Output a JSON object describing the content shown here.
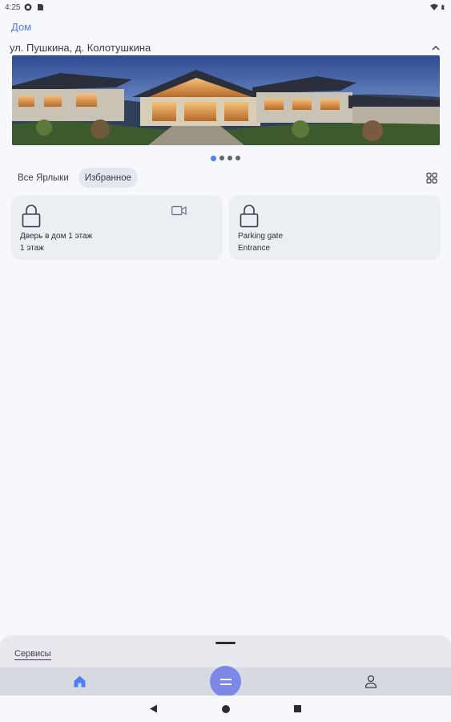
{
  "status_bar": {
    "time": "4:25",
    "icons": [
      "sync-icon",
      "sim-card-icon",
      "wifi-icon",
      "battery-icon"
    ]
  },
  "header": {
    "home_link": "Дом",
    "address": "ул. Пушкина, д. Колотушкина",
    "collapse_icon": "chevron-up-icon"
  },
  "hero": {
    "image": "house-photo",
    "pager": {
      "pages": 4,
      "current": 1
    }
  },
  "filters": {
    "chips": [
      {
        "label": "Все Ярлыки",
        "selected": false
      },
      {
        "label": "Избранное",
        "selected": true
      }
    ],
    "view_toggle_icon": "grid-view-icon"
  },
  "cards": [
    {
      "name": "Дверь в дом 1 этаж",
      "subtitle": "1 этаж",
      "icon": "lock-icon",
      "has_camera": true
    },
    {
      "name": "Parking gate",
      "subtitle": "Entrance",
      "icon": "lock-icon",
      "has_camera": false
    }
  ],
  "sheet": {
    "services_label": "Сервисы"
  },
  "bottom_nav": {
    "home_icon": "home-icon",
    "fab_icon": "menu-icon",
    "profile_icon": "profile-icon"
  },
  "colors": {
    "accent": "#4f7df3",
    "fab": "#7b88e6",
    "card_bg": "#ebeef3",
    "background": "#f7f8fb"
  }
}
